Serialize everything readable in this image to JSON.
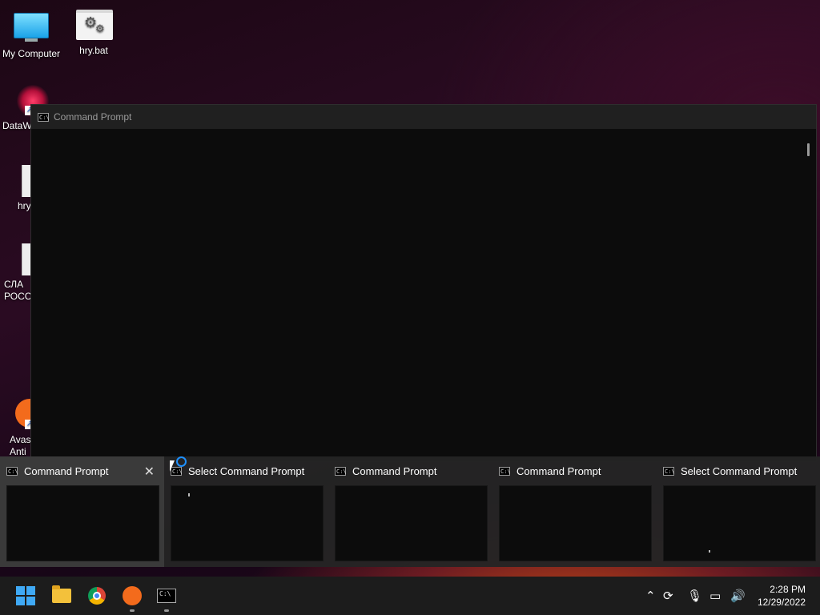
{
  "desktop": {
    "icons": [
      {
        "label": "My Computer"
      },
      {
        "label": "hry.bat"
      },
      {
        "label": "DataW"
      },
      {
        "label": "hry"
      },
      {
        "label": "СЛА\nРОСС"
      },
      {
        "label": "Avast\nAnti"
      }
    ]
  },
  "cmd_window": {
    "title": "Command Prompt",
    "icon": "cmd-icon"
  },
  "task_view": {
    "windows": [
      {
        "title": "Command Prompt",
        "icon": "cmd-icon",
        "close": "✕"
      },
      {
        "title": "Select Command Prompt",
        "icon": "cmd-icon"
      },
      {
        "title": "Command Prompt",
        "icon": "cmd-icon"
      },
      {
        "title": "Command Prompt",
        "icon": "cmd-icon"
      },
      {
        "title": "Select Command Prompt",
        "icon": "cmd-icon"
      }
    ]
  },
  "taskbar": {
    "apps": [
      "windows-start-icon",
      "file-explorer-icon",
      "chrome-icon",
      "avast-icon",
      "command-prompt-icon"
    ],
    "tray_icons": [
      "chevron-up-icon",
      "sync-icon",
      "microphone-icon",
      "network-icon",
      "speaker-icon"
    ],
    "time": "2:28 PM",
    "date": "12/29/2022"
  },
  "colors": {
    "accent": "#3fa9f5",
    "console_bg": "#0c0c0c",
    "titlebar_bg": "#202020"
  }
}
